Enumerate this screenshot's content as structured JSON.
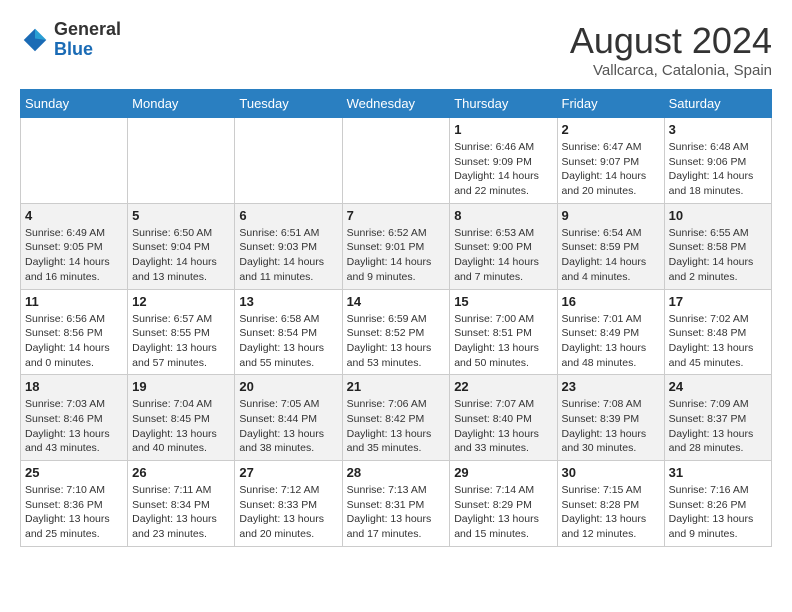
{
  "header": {
    "logo_general": "General",
    "logo_blue": "Blue",
    "month_title": "August 2024",
    "location": "Vallcarca, Catalonia, Spain"
  },
  "days_of_week": [
    "Sunday",
    "Monday",
    "Tuesday",
    "Wednesday",
    "Thursday",
    "Friday",
    "Saturday"
  ],
  "weeks": [
    [
      {
        "day": "",
        "info": ""
      },
      {
        "day": "",
        "info": ""
      },
      {
        "day": "",
        "info": ""
      },
      {
        "day": "",
        "info": ""
      },
      {
        "day": "1",
        "info": "Sunrise: 6:46 AM\nSunset: 9:09 PM\nDaylight: 14 hours\nand 22 minutes."
      },
      {
        "day": "2",
        "info": "Sunrise: 6:47 AM\nSunset: 9:07 PM\nDaylight: 14 hours\nand 20 minutes."
      },
      {
        "day": "3",
        "info": "Sunrise: 6:48 AM\nSunset: 9:06 PM\nDaylight: 14 hours\nand 18 minutes."
      }
    ],
    [
      {
        "day": "4",
        "info": "Sunrise: 6:49 AM\nSunset: 9:05 PM\nDaylight: 14 hours\nand 16 minutes."
      },
      {
        "day": "5",
        "info": "Sunrise: 6:50 AM\nSunset: 9:04 PM\nDaylight: 14 hours\nand 13 minutes."
      },
      {
        "day": "6",
        "info": "Sunrise: 6:51 AM\nSunset: 9:03 PM\nDaylight: 14 hours\nand 11 minutes."
      },
      {
        "day": "7",
        "info": "Sunrise: 6:52 AM\nSunset: 9:01 PM\nDaylight: 14 hours\nand 9 minutes."
      },
      {
        "day": "8",
        "info": "Sunrise: 6:53 AM\nSunset: 9:00 PM\nDaylight: 14 hours\nand 7 minutes."
      },
      {
        "day": "9",
        "info": "Sunrise: 6:54 AM\nSunset: 8:59 PM\nDaylight: 14 hours\nand 4 minutes."
      },
      {
        "day": "10",
        "info": "Sunrise: 6:55 AM\nSunset: 8:58 PM\nDaylight: 14 hours\nand 2 minutes."
      }
    ],
    [
      {
        "day": "11",
        "info": "Sunrise: 6:56 AM\nSunset: 8:56 PM\nDaylight: 14 hours\nand 0 minutes."
      },
      {
        "day": "12",
        "info": "Sunrise: 6:57 AM\nSunset: 8:55 PM\nDaylight: 13 hours\nand 57 minutes."
      },
      {
        "day": "13",
        "info": "Sunrise: 6:58 AM\nSunset: 8:54 PM\nDaylight: 13 hours\nand 55 minutes."
      },
      {
        "day": "14",
        "info": "Sunrise: 6:59 AM\nSunset: 8:52 PM\nDaylight: 13 hours\nand 53 minutes."
      },
      {
        "day": "15",
        "info": "Sunrise: 7:00 AM\nSunset: 8:51 PM\nDaylight: 13 hours\nand 50 minutes."
      },
      {
        "day": "16",
        "info": "Sunrise: 7:01 AM\nSunset: 8:49 PM\nDaylight: 13 hours\nand 48 minutes."
      },
      {
        "day": "17",
        "info": "Sunrise: 7:02 AM\nSunset: 8:48 PM\nDaylight: 13 hours\nand 45 minutes."
      }
    ],
    [
      {
        "day": "18",
        "info": "Sunrise: 7:03 AM\nSunset: 8:46 PM\nDaylight: 13 hours\nand 43 minutes."
      },
      {
        "day": "19",
        "info": "Sunrise: 7:04 AM\nSunset: 8:45 PM\nDaylight: 13 hours\nand 40 minutes."
      },
      {
        "day": "20",
        "info": "Sunrise: 7:05 AM\nSunset: 8:44 PM\nDaylight: 13 hours\nand 38 minutes."
      },
      {
        "day": "21",
        "info": "Sunrise: 7:06 AM\nSunset: 8:42 PM\nDaylight: 13 hours\nand 35 minutes."
      },
      {
        "day": "22",
        "info": "Sunrise: 7:07 AM\nSunset: 8:40 PM\nDaylight: 13 hours\nand 33 minutes."
      },
      {
        "day": "23",
        "info": "Sunrise: 7:08 AM\nSunset: 8:39 PM\nDaylight: 13 hours\nand 30 minutes."
      },
      {
        "day": "24",
        "info": "Sunrise: 7:09 AM\nSunset: 8:37 PM\nDaylight: 13 hours\nand 28 minutes."
      }
    ],
    [
      {
        "day": "25",
        "info": "Sunrise: 7:10 AM\nSunset: 8:36 PM\nDaylight: 13 hours\nand 25 minutes."
      },
      {
        "day": "26",
        "info": "Sunrise: 7:11 AM\nSunset: 8:34 PM\nDaylight: 13 hours\nand 23 minutes."
      },
      {
        "day": "27",
        "info": "Sunrise: 7:12 AM\nSunset: 8:33 PM\nDaylight: 13 hours\nand 20 minutes."
      },
      {
        "day": "28",
        "info": "Sunrise: 7:13 AM\nSunset: 8:31 PM\nDaylight: 13 hours\nand 17 minutes."
      },
      {
        "day": "29",
        "info": "Sunrise: 7:14 AM\nSunset: 8:29 PM\nDaylight: 13 hours\nand 15 minutes."
      },
      {
        "day": "30",
        "info": "Sunrise: 7:15 AM\nSunset: 8:28 PM\nDaylight: 13 hours\nand 12 minutes."
      },
      {
        "day": "31",
        "info": "Sunrise: 7:16 AM\nSunset: 8:26 PM\nDaylight: 13 hours\nand 9 minutes."
      }
    ]
  ]
}
